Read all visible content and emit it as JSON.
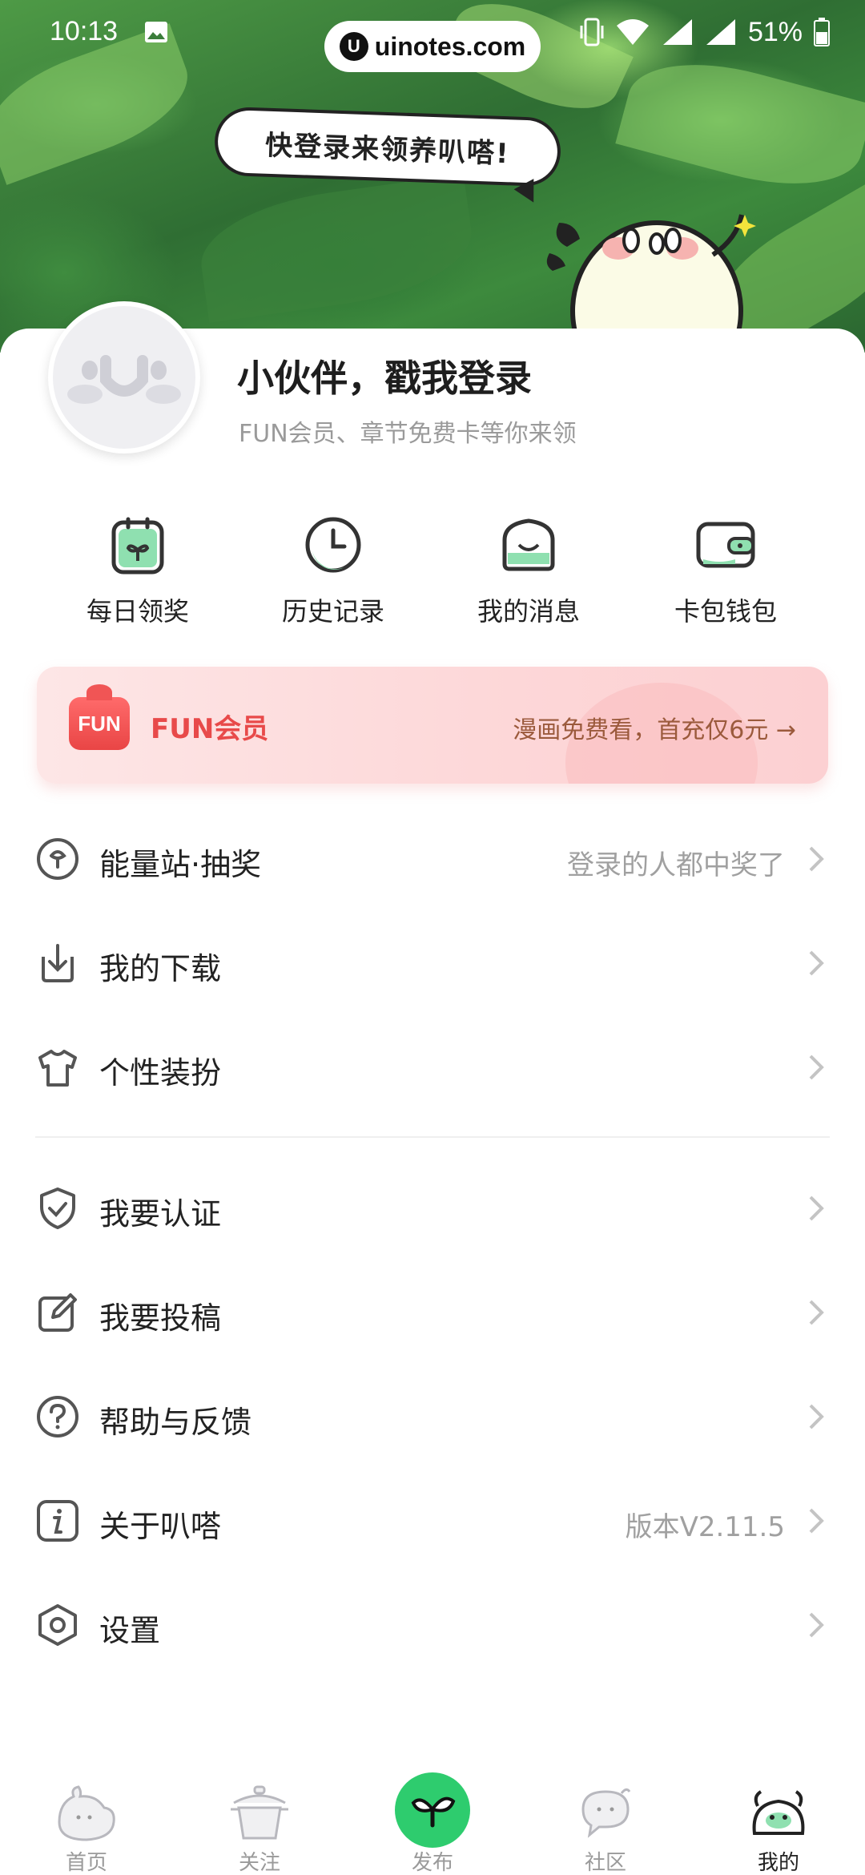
{
  "status_bar": {
    "time": "10:13",
    "battery": "51%",
    "watermark": "uinotes.com"
  },
  "banner": {
    "speech": "快登录来领养叭嗒!"
  },
  "profile": {
    "title": "小伙伴，戳我登录",
    "subtitle": "FUN会员、章节免费卡等你来领"
  },
  "quick_actions": [
    {
      "label": "每日领奖",
      "icon": "daily-reward-icon"
    },
    {
      "label": "历史记录",
      "icon": "history-icon"
    },
    {
      "label": "我的消息",
      "icon": "message-icon"
    },
    {
      "label": "卡包钱包",
      "icon": "wallet-icon"
    }
  ],
  "fun_member": {
    "badge": "FUN",
    "title": "FUN会员",
    "promo": "漫画免费看，首充仅6元 →"
  },
  "menu": [
    {
      "label": "能量站·抽奖",
      "value": "登录的人都中奖了",
      "icon": "lottery-icon"
    },
    {
      "label": "我的下载",
      "value": "",
      "icon": "download-icon"
    },
    {
      "label": "个性装扮",
      "value": "",
      "icon": "tshirt-icon"
    },
    {
      "label": "我要认证",
      "value": "",
      "icon": "shield-check-icon"
    },
    {
      "label": "我要投稿",
      "value": "",
      "icon": "edit-icon"
    },
    {
      "label": "帮助与反馈",
      "value": "",
      "icon": "help-icon"
    },
    {
      "label": "关于叭嗒",
      "value": "版本V2.11.5",
      "icon": "info-icon"
    },
    {
      "label": "设置",
      "value": "",
      "icon": "settings-icon"
    }
  ],
  "bottom_nav": [
    {
      "label": "首页",
      "icon": "home-icon",
      "active": false
    },
    {
      "label": "关注",
      "icon": "follow-icon",
      "active": false
    },
    {
      "label": "发布",
      "icon": "publish-icon",
      "active": false
    },
    {
      "label": "社区",
      "icon": "community-icon",
      "active": false
    },
    {
      "label": "我的",
      "icon": "profile-icon",
      "active": true
    }
  ],
  "colors": {
    "accent_green": "#2ecc6e",
    "fun_red": "#e84a4a",
    "promo_brown": "#9b5a3c"
  }
}
